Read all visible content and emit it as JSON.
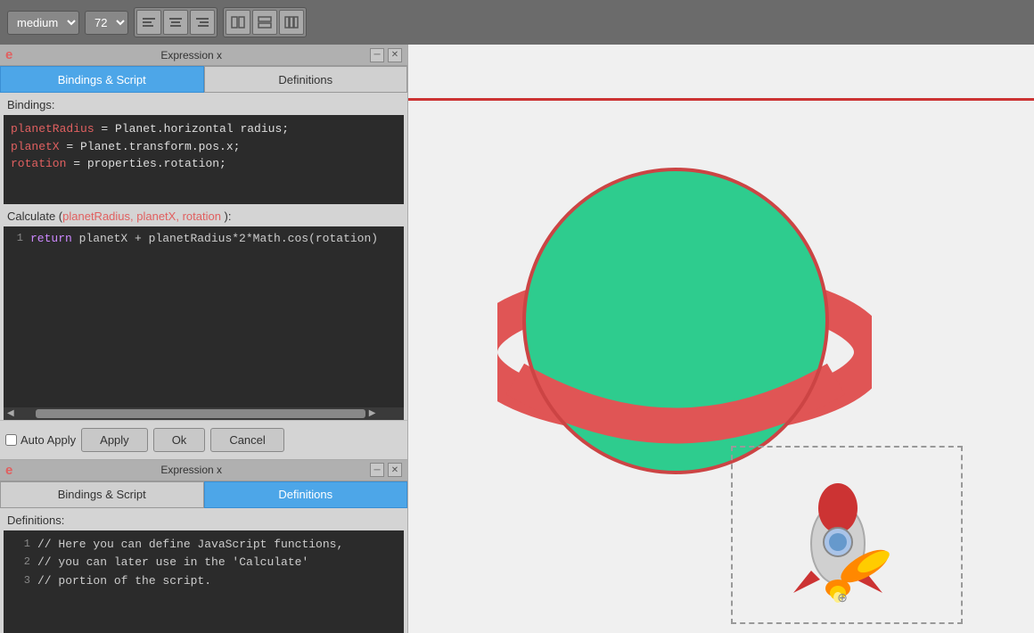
{
  "toolbar": {
    "medium_label": "medium",
    "size_label": "72",
    "align_btns": [
      "≡",
      "≡",
      "≡"
    ],
    "layout_btns": [
      "▦",
      "▦",
      "▦"
    ]
  },
  "expr_top": {
    "title": "Expression x",
    "tab_bindings": "Bindings & Script",
    "tab_definitions": "Definitions",
    "bindings_label": "Bindings:",
    "binding_line1": "planetRadius = Planet.horizontal radius;",
    "binding_line2": "planetX = Planet.transform.pos.x;",
    "binding_line3": "rotation = properties.rotation;",
    "calculate_label_prefix": "Calculate (",
    "calculate_params": "planetRadius, planetX, rotation",
    "calculate_label_suffix": " ):",
    "code_line1": "return planetX + planetRadius*2*Math.cos(rotation)",
    "apply_btn": "Apply",
    "ok_btn": "Ok",
    "cancel_btn": "Cancel",
    "auto_apply_label": "Auto Apply"
  },
  "expr_bottom": {
    "title": "Expression x",
    "tab_bindings": "Bindings & Script",
    "tab_definitions": "Definitions",
    "definitions_label": "Definitions:",
    "def_line1": "// Here you can define JavaScript functions,",
    "def_line2": "// you can later use in the 'Calculate'",
    "def_line3": "// portion of the script."
  }
}
